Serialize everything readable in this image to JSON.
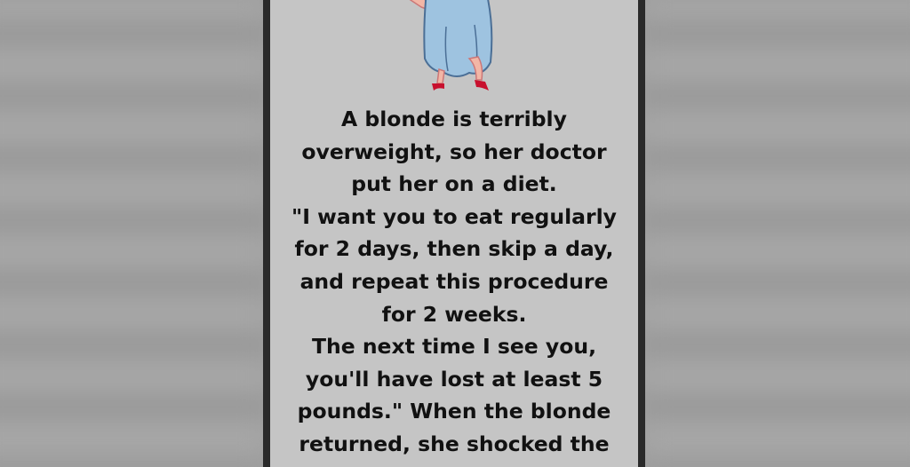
{
  "joke": {
    "lines": [
      "A blonde is terribly",
      "overweight, so her doctor",
      "put her on a diet.",
      "\"I want you to eat regularly",
      "for 2 days, then skip a day,",
      "and repeat this procedure",
      "for 2 weeks.",
      "The next time I see you,",
      "you'll have lost at least 5",
      "pounds.\" When the blonde",
      "returned, she shocked the"
    ]
  },
  "colors": {
    "panel_background": "#c5c5c5",
    "text": "#111111",
    "dress": "#9ec3e0",
    "shoes": "#c8102e"
  },
  "illustration": {
    "icon": "cartoon-woman-in-blue-dress-icon"
  }
}
